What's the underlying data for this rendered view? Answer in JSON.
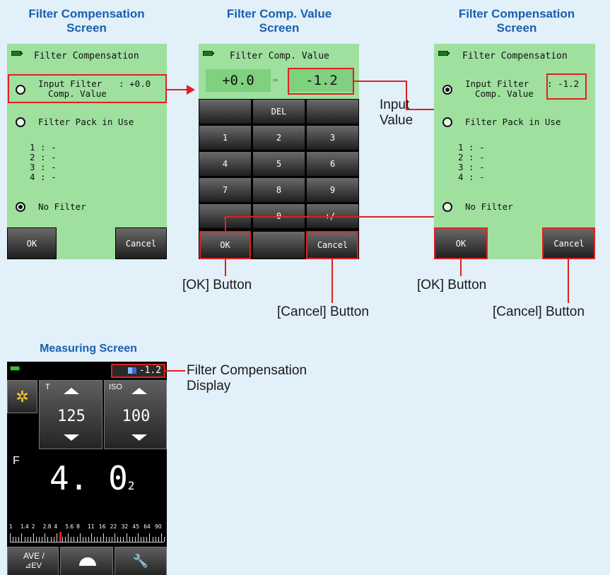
{
  "captions": {
    "left": [
      "Filter Compensation",
      "Screen"
    ],
    "middle": [
      "Filter Comp. Value",
      "Screen"
    ],
    "right": [
      "Filter Compensation",
      "Screen"
    ],
    "measuring": "Measuring Screen"
  },
  "left_screen": {
    "title": "Filter Compensation",
    "input_filter_label": "Input Filter",
    "input_filter_value": ": +0.0",
    "comp_value_label": "Comp. Value",
    "filter_pack_label": "Filter Pack in Use",
    "slots": [
      "1 : -",
      "2 : -",
      "3 : -",
      "4 : -"
    ],
    "no_filter_label": "No Filter",
    "ok_label": "OK",
    "cancel_label": "Cancel",
    "selected": "No Filter"
  },
  "middle_screen": {
    "title": "Filter Comp. Value",
    "current_value": "+0.0",
    "arrow": "⇒",
    "new_value": "-1.2",
    "keys": [
      [
        "",
        "DEL",
        ""
      ],
      [
        "1",
        "2",
        "3"
      ],
      [
        "4",
        "5",
        "6"
      ],
      [
        "7",
        "8",
        "9"
      ],
      [
        ".",
        "0",
        "+/-"
      ]
    ],
    "ok_label": "OK",
    "cancel_label": "Cancel"
  },
  "right_screen": {
    "title": "Filter Compensation",
    "input_filter_label": "Input Filter",
    "input_filter_value": ": -1.2",
    "comp_value_label": "Comp. Value",
    "filter_pack_label": "Filter Pack in Use",
    "slots": [
      "1 : -",
      "2 : -",
      "3 : -",
      "4 : -"
    ],
    "no_filter_label": "No Filter",
    "ok_label": "OK",
    "cancel_label": "Cancel",
    "selected": "Input Filter Comp. Value"
  },
  "notes": {
    "input_value": [
      "Input",
      "Value"
    ],
    "ok_button": "[OK] Button",
    "cancel_button": "[Cancel] Button",
    "ok_button_right": "[OK] Button",
    "cancel_button_right": "[Cancel] Button",
    "filter_comp_display": [
      "Filter Compensation",
      "Display"
    ]
  },
  "measuring_screen": {
    "filter_value": "-1.2",
    "t_label": "T",
    "t_value": "125",
    "iso_label": "ISO",
    "iso_value": "100",
    "f_label": "F",
    "f_value": "4. 0",
    "f_sub": "2",
    "scale_labels": [
      "1",
      "1.4",
      "2",
      "2.8",
      "4",
      "5.6",
      "8",
      "11",
      "16",
      "22",
      "32",
      "45",
      "64",
      "90"
    ],
    "ave_label": [
      "AVE /",
      "⊿EV"
    ]
  },
  "colors": {
    "screen_green": "#9fe09f",
    "value_green": "#7fd07f",
    "annotation_red": "#e02020",
    "caption_blue": "#1a5fae",
    "background": "#e1f0f9"
  }
}
